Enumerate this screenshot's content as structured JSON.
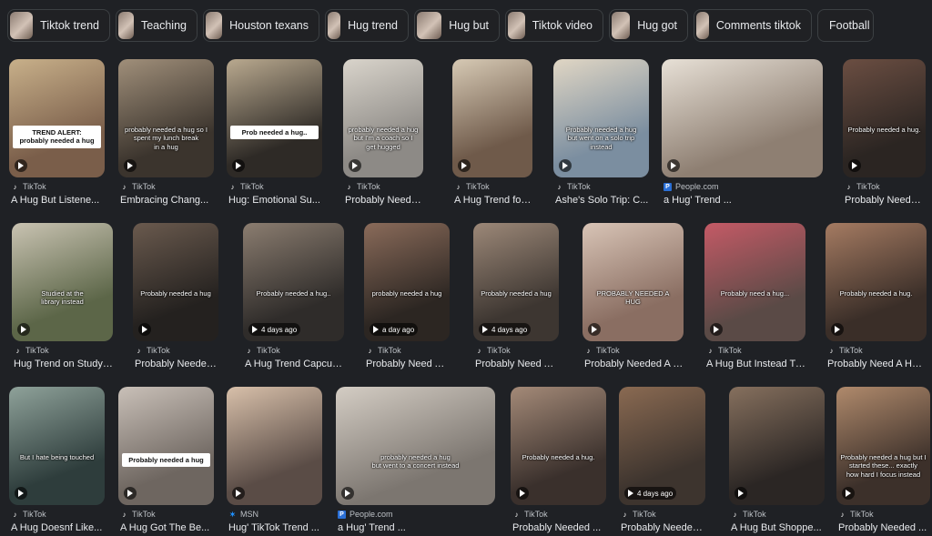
{
  "chips": [
    {
      "label": "Tiktok trend",
      "thumb": true
    },
    {
      "label": "Teaching",
      "thumb": true
    },
    {
      "label": "Houston texans",
      "thumb": true
    },
    {
      "label": "Hug trend",
      "thumb": true
    },
    {
      "label": "Hug but",
      "thumb": true
    },
    {
      "label": "Tiktok video",
      "thumb": true
    },
    {
      "label": "Hug got",
      "thumb": true
    },
    {
      "label": "Comments tiktok",
      "thumb": true
    },
    {
      "label": "Football",
      "thumb": false
    }
  ],
  "rows": [
    [
      {
        "source": "TikTok",
        "icon": "tiktok-icon",
        "title": "A Hug But Listene...",
        "overlay": "TREND ALERT:\nprobably needed a hug",
        "overlay_style": "boxed",
        "duration": "",
        "c1": "#7a5e4a",
        "c2": "#c8b08a"
      },
      {
        "source": "TikTok",
        "icon": "tiktok-icon",
        "title": "Embracing Chang...",
        "overlay": "probably needed a hug so I\nspent my lunch break\nin a hug",
        "overlay_style": "",
        "duration": "",
        "c1": "#3b342d",
        "c2": "#a08f7a"
      },
      {
        "source": "TikTok",
        "icon": "tiktok-icon",
        "title": "Hug: Emotional Su...",
        "overlay": "Prob needed a hug..",
        "overlay_style": "boxed",
        "duration": "",
        "c1": "#2e2a26",
        "c2": "#b9a98f"
      },
      {
        "source": "TikTok",
        "icon": "tiktok-icon",
        "title": "Probably Needed ...",
        "overlay": "probably needed a hug\nbut I'm a coach so I\nget hugged",
        "overlay_style": "",
        "duration": "",
        "c1": "#8d8a86",
        "c2": "#d9d4cb"
      },
      {
        "source": "TikTok",
        "icon": "tiktok-icon",
        "title": "A Hug Trend for Te...",
        "overlay": "",
        "overlay_style": "",
        "duration": "",
        "c1": "#6f5a4a",
        "c2": "#d6c9b4"
      },
      {
        "source": "TikTok",
        "icon": "tiktok-icon",
        "title": "Ashe's Solo Trip: C...",
        "overlay": "Probably needed a hug\nbut went on a solo trip\ninstead",
        "overlay_style": "",
        "duration": "",
        "c1": "#7b8ea0",
        "c2": "#e0d6c4"
      },
      {
        "source": "People.com",
        "icon": "people-icon",
        "title": "a Hug' Trend ...",
        "overlay": "",
        "overlay_style": "",
        "duration": "",
        "c1": "#8e7f72",
        "c2": "#e7e0d6"
      },
      {
        "source": "TikTok",
        "icon": "tiktok-icon",
        "title": "Probably Needed ...",
        "overlay": "Probably needed a hug.",
        "overlay_style": "",
        "duration": "",
        "c1": "#2b2522",
        "c2": "#6b4e42"
      }
    ],
    [
      {
        "source": "TikTok",
        "icon": "tiktok-icon",
        "title": "Hug Trend on StudyT...",
        "overlay": "Studied at the\nlibrary instead",
        "overlay_style": "",
        "duration": "",
        "c1": "#5c6648",
        "c2": "#c9c3b2"
      },
      {
        "source": "TikTok",
        "icon": "tiktok-icon",
        "title": "Probably Needed ...",
        "overlay": "Probably needed a hug",
        "overlay_style": "",
        "duration": "",
        "c1": "#24211f",
        "c2": "#6a5a4e"
      },
      {
        "source": "TikTok",
        "icon": "tiktok-icon",
        "title": "A Hug Trend Capcut T...",
        "overlay": "Probably needed a hug..",
        "overlay_style": "",
        "duration": "4 days ago",
        "c1": "#2f2c2a",
        "c2": "#8b7d70"
      },
      {
        "source": "TikTok",
        "icon": "tiktok-icon",
        "title": "Probably Need A H...",
        "overlay": "probably needed a hug",
        "overlay_style": "",
        "duration": "a day ago",
        "c1": "#2c2622",
        "c2": "#8a6b5a"
      },
      {
        "source": "TikTok",
        "icon": "tiktok-icon",
        "title": "Probably Need A H...",
        "overlay": "Probably needed a hug",
        "overlay_style": "",
        "duration": "4 days ago",
        "c1": "#3d3631",
        "c2": "#9c8878"
      },
      {
        "source": "TikTok",
        "icon": "tiktok-icon",
        "title": "Probably Needed A H...",
        "overlay": "PROBABLY NEEDED A\nHUG",
        "overlay_style": "",
        "duration": "",
        "c1": "#8a6e62",
        "c2": "#d8c4b6"
      },
      {
        "source": "TikTok",
        "icon": "tiktok-icon",
        "title": "A Hug But Instead Tre...",
        "overlay": "Probably need a hug...",
        "overlay_style": "",
        "duration": "",
        "c1": "#5a4a46",
        "c2": "#c45a66"
      },
      {
        "source": "TikTok",
        "icon": "tiktok-icon",
        "title": "Probably Need A Hug ...",
        "overlay": "Probably needed a hug.",
        "overlay_style": "",
        "duration": "",
        "c1": "#3a2e28",
        "c2": "#a57b62"
      }
    ],
    [
      {
        "source": "TikTok",
        "icon": "tiktok-icon",
        "title": "A Hug Doesnf Like...",
        "overlay": "But I hate being touched",
        "overlay_style": "",
        "duration": "",
        "c1": "#2e3d3c",
        "c2": "#8fa29a"
      },
      {
        "source": "TikTok",
        "icon": "tiktok-icon",
        "title": "A Hug Got The Be...",
        "overlay": "Probably needed a hug",
        "overlay_style": "boxed",
        "duration": "",
        "c1": "#6e6660",
        "c2": "#c9c0b8"
      },
      {
        "source": "MSN",
        "icon": "msn-icon",
        "title": "Hug' TikTok Trend ...",
        "overlay": "",
        "overlay_style": "",
        "duration": "",
        "c1": "#5a4c46",
        "c2": "#d8c0aa"
      },
      {
        "source": "People.com",
        "icon": "people-icon",
        "title": "a Hug' Trend ...",
        "overlay": "probably needed a hug\nbut went to a concert instead",
        "overlay_style": "",
        "duration": "",
        "c1": "#7c7670",
        "c2": "#d4cdc4"
      },
      {
        "source": "TikTok",
        "icon": "tiktok-icon",
        "title": "Probably Needed ...",
        "overlay": "Probably needed a hug.",
        "overlay_style": "",
        "duration": "",
        "c1": "#3a302c",
        "c2": "#a48a78"
      },
      {
        "source": "TikTok",
        "icon": "tiktok-icon",
        "title": "Probably Needed ...",
        "overlay": "",
        "overlay_style": "",
        "duration": "4 days ago",
        "c1": "#3d342e",
        "c2": "#8a6a52"
      },
      {
        "source": "TikTok",
        "icon": "tiktok-icon",
        "title": "A Hug But Shoppe...",
        "overlay": "",
        "overlay_style": "",
        "duration": "",
        "c1": "#2b2624",
        "c2": "#86705e"
      },
      {
        "source": "TikTok",
        "icon": "tiktok-icon",
        "title": "Probably Needed ...",
        "overlay": "Probably needed a hug but I\nstarted these... exactly\nhow hard I focus instead",
        "overlay_style": "",
        "duration": "",
        "c1": "#3c302a",
        "c2": "#b08a6c"
      }
    ]
  ]
}
